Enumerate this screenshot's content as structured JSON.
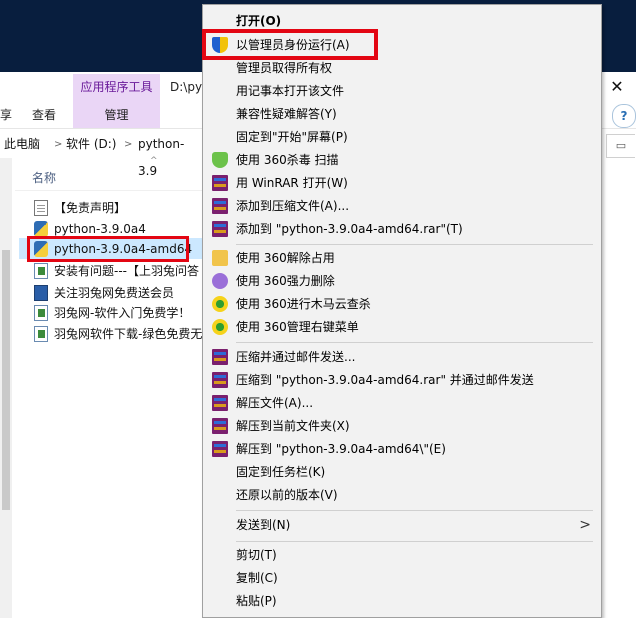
{
  "window": {
    "path_prefix": "D:\\py",
    "ribbon": {
      "context_group": "应用程序工具",
      "manage_tab": "管理",
      "view_tab": "查看",
      "left_partial": "享"
    },
    "address": {
      "crumbs": [
        "此电脑",
        "软件 (D:)",
        "python-3.9"
      ],
      "separator": ">"
    },
    "help": "?",
    "close": "✕",
    "search_edge": "▭"
  },
  "file_list": {
    "column_header": "名称",
    "sort_indicator": "^",
    "files": [
      {
        "name": "【免责声明】",
        "icon": "document-icon"
      },
      {
        "name": "python-3.9.0a4",
        "icon": "python-icon"
      },
      {
        "name": "python-3.9.0a4-amd64",
        "icon": "python-icon",
        "selected": true
      },
      {
        "name": "安装有问题---【上羽兔问答",
        "icon": "internet-shortcut-icon"
      },
      {
        "name": "关注羽兔网免费送会员",
        "icon": "web-icon"
      },
      {
        "name": "羽兔网-软件入门免费学！",
        "icon": "internet-shortcut-icon"
      },
      {
        "name": "羽兔网软件下载-绿色免费无",
        "icon": "internet-shortcut-icon"
      }
    ]
  },
  "context_menu": {
    "items": [
      {
        "label": "打开(O)",
        "icon": "none",
        "bold": true
      },
      {
        "label": "以管理员身份运行(A)",
        "icon": "uac-shield-icon"
      },
      {
        "label": "管理员取得所有权",
        "icon": "none"
      },
      {
        "label": "用记事本打开该文件",
        "icon": "none"
      },
      {
        "label": "兼容性疑难解答(Y)",
        "icon": "none"
      },
      {
        "label": "固定到\"开始\"屏幕(P)",
        "icon": "none"
      },
      {
        "label": "使用 360杀毒 扫描",
        "icon": "360-antivirus-icon"
      },
      {
        "label": "用 WinRAR 打开(W)",
        "icon": "winrar-icon"
      },
      {
        "label": "添加到压缩文件(A)...",
        "icon": "winrar-icon"
      },
      {
        "label": "添加到 \"python-3.9.0a4-amd64.rar\"(T)",
        "icon": "winrar-icon"
      },
      {
        "separator": true
      },
      {
        "label": "使用 360解除占用",
        "icon": "360-unlock-icon"
      },
      {
        "label": "使用 360强力删除",
        "icon": "360-delete-icon"
      },
      {
        "label": "使用 360进行木马云查杀",
        "icon": "360-trojan-icon"
      },
      {
        "label": "使用 360管理右键菜单",
        "icon": "360-menu-manage-icon"
      },
      {
        "separator": true
      },
      {
        "label": "压缩并通过邮件发送...",
        "icon": "winrar-icon"
      },
      {
        "label": "压缩到 \"python-3.9.0a4-amd64.rar\" 并通过邮件发送",
        "icon": "winrar-icon"
      },
      {
        "label": "解压文件(A)...",
        "icon": "winrar-icon"
      },
      {
        "label": "解压到当前文件夹(X)",
        "icon": "winrar-icon"
      },
      {
        "label": "解压到 \"python-3.9.0a4-amd64\\\"(E)",
        "icon": "winrar-icon"
      },
      {
        "label": "固定到任务栏(K)",
        "icon": "none"
      },
      {
        "label": "还原以前的版本(V)",
        "icon": "none"
      },
      {
        "separator": true
      },
      {
        "label": "发送到(N)",
        "icon": "none",
        "submenu": true,
        "chevron": ">"
      },
      {
        "separator": true
      },
      {
        "label": "剪切(T)",
        "icon": "none"
      },
      {
        "label": "复制(C)",
        "icon": "none"
      },
      {
        "label": "粘贴(P)",
        "icon": "none"
      }
    ]
  },
  "colors": {
    "highlight_red": "#e30613",
    "menu_background": "#f2f2f2",
    "selection_blue": "#cce8ff",
    "ribbon_purple": "#ead6f6",
    "desktop_navy": "#081e3e"
  }
}
